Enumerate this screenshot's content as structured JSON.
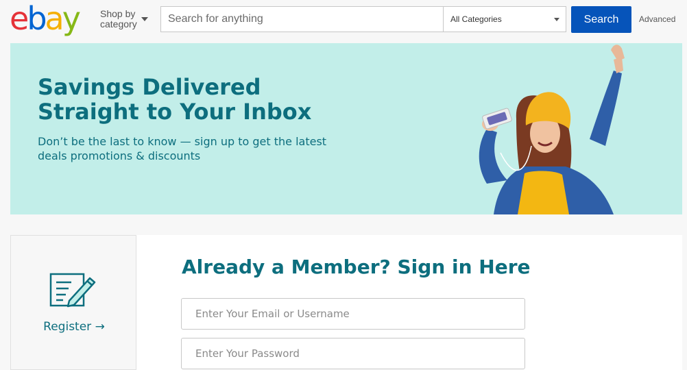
{
  "header": {
    "logo": {
      "l1": "e",
      "l2": "b",
      "l3": "a",
      "l4": "y"
    },
    "shop_by_line1": "Shop by",
    "shop_by_line2": "category",
    "search_placeholder": "Search for anything",
    "category_selected": "All Categories",
    "search_button": "Search",
    "advanced_link": "Advanced"
  },
  "banner": {
    "title": "Savings Delivered Straight to Your Inbox",
    "subtitle": "Don’t be the last to know — sign up to get the latest deals promotions & discounts",
    "background": "#c2eee9",
    "text_color": "#0d6e7e"
  },
  "register": {
    "link_label": "Register →",
    "icon": "register-form-pencil-icon"
  },
  "signin": {
    "title": "Already a Member? Sign in Here",
    "email_placeholder": "Enter Your Email or Username",
    "password_placeholder": "Enter Your Password"
  },
  "colors": {
    "brand_red": "#e53238",
    "brand_blue": "#0064d2",
    "brand_yellow": "#f5af02",
    "brand_green": "#86b817",
    "search_button": "#0654ba",
    "teal": "#0d6e7e"
  }
}
